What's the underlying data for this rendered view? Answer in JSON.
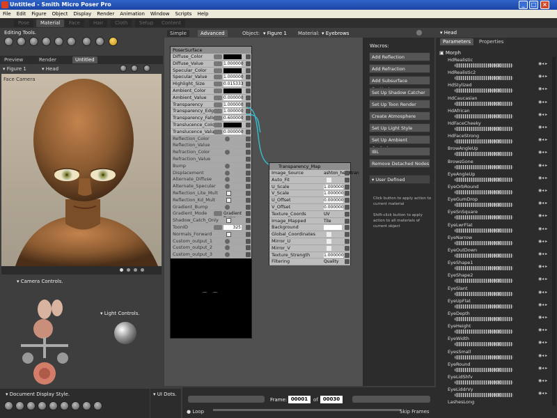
{
  "window": {
    "title": "Untitled - Smith Micro Poser Pro"
  },
  "menu": [
    "File",
    "Edit",
    "Figure",
    "Object",
    "Display",
    "Render",
    "Animation",
    "Window",
    "Scripts",
    "Help"
  ],
  "rooms": [
    {
      "label": "Pose",
      "active": false
    },
    {
      "label": "Material",
      "active": true
    },
    {
      "label": "Face",
      "active": false
    },
    {
      "label": "Hair",
      "active": false
    },
    {
      "label": "Cloth",
      "active": false
    },
    {
      "label": "Setup",
      "active": false
    },
    {
      "label": "Content",
      "active": false
    }
  ],
  "editing_tools": {
    "label": "Editing Tools."
  },
  "doc_tabs": [
    "Preview",
    "Render",
    "Untitled"
  ],
  "figure_select": {
    "figure": "Figure 1",
    "part": "Head"
  },
  "viewport": {
    "camera": "Face Camera"
  },
  "camera_controls": {
    "label": "Camera Controls."
  },
  "light_controls": {
    "label": "Light Controls."
  },
  "doc_display": {
    "label": "Document Display Style."
  },
  "ui_dots": {
    "label": "UI Dots."
  },
  "material_tabs": {
    "simple": "Simple",
    "advanced": "Advanced",
    "object_label": "Object:",
    "object_value": "Figure 1",
    "material_label": "Material:",
    "material_value": "Eyebrows"
  },
  "poser_surface": {
    "title": "PoserSurface",
    "rows": [
      {
        "label": "Diffuse_Color",
        "type": "color",
        "value": ""
      },
      {
        "label": "Diffuse_Value",
        "type": "num",
        "value": "1.000000"
      },
      {
        "label": "Specular_Color",
        "type": "color",
        "value": ""
      },
      {
        "label": "Specular_Value",
        "type": "num",
        "value": "1.000000"
      },
      {
        "label": "Highlight_Size",
        "type": "num",
        "value": "0.015333"
      },
      {
        "label": "Ambient_Color",
        "type": "color",
        "value": ""
      },
      {
        "label": "Ambient_Value",
        "type": "num",
        "value": "0.000000"
      },
      {
        "label": "Transparency",
        "type": "num",
        "value": "1.000000"
      },
      {
        "label": "Transparency_Edge",
        "type": "num",
        "value": "1.000000"
      },
      {
        "label": "Transparency_Falloff",
        "type": "num",
        "value": "0.600000"
      },
      {
        "label": "Translucence_Color",
        "type": "color",
        "value": ""
      },
      {
        "label": "Translucence_Value",
        "type": "num",
        "value": "0.000000"
      },
      {
        "label": "Reflection_Color",
        "type": "q",
        "value": ""
      },
      {
        "label": "Reflection_Value",
        "type": "plain",
        "value": ""
      },
      {
        "label": "Refraction_Color",
        "type": "q",
        "value": ""
      },
      {
        "label": "Refraction_Value",
        "type": "plain",
        "value": ""
      },
      {
        "label": "Bump",
        "type": "q",
        "value": ""
      },
      {
        "label": "Displacement",
        "type": "q",
        "value": ""
      },
      {
        "label": "Alternate_Diffuse",
        "type": "q",
        "value": ""
      },
      {
        "label": "Alternate_Specular",
        "type": "q",
        "value": ""
      },
      {
        "label": "Reflection_Lite_Mult",
        "type": "cb",
        "value": ""
      },
      {
        "label": "Reflection_Kd_Mult",
        "type": "cb",
        "value": ""
      },
      {
        "label": "Gradient_Bump",
        "type": "q",
        "value": ""
      },
      {
        "label": "Gradient_Mode",
        "type": "text",
        "value": "Gradient Bump"
      },
      {
        "label": "Shadow_Catch_Only",
        "type": "cb",
        "value": ""
      },
      {
        "label": "ToonID",
        "type": "num",
        "value": "325"
      },
      {
        "label": "Normals_Forward",
        "type": "cb",
        "value": ""
      },
      {
        "label": "Custom_output_1",
        "type": "q",
        "value": ""
      },
      {
        "label": "Custom_output_2",
        "type": "q",
        "value": ""
      },
      {
        "label": "Custom_output_3",
        "type": "q",
        "value": ""
      }
    ]
  },
  "transparency_map": {
    "title": "Transparency_Map",
    "rows": [
      {
        "label": "Image_Source",
        "value": "ashton_headtran"
      },
      {
        "label": "Auto_Fit",
        "value": ""
      },
      {
        "label": "U_Scale",
        "value": "1.000000"
      },
      {
        "label": "V_Scale",
        "value": "1.000000"
      },
      {
        "label": "U_Offset",
        "value": "0.000000"
      },
      {
        "label": "V_Offset",
        "value": "0.000000"
      },
      {
        "label": "Texture_Coords",
        "value": "UV"
      },
      {
        "label": "Image_Mapped",
        "value": "Tile"
      },
      {
        "label": "Background",
        "value": ""
      },
      {
        "label": "Global_Coordinates",
        "value": ""
      },
      {
        "label": "Mirror_U",
        "value": ""
      },
      {
        "label": "Mirror_V",
        "value": ""
      },
      {
        "label": "Texture_Strength",
        "value": "1.000000"
      },
      {
        "label": "Filtering",
        "value": "Quality"
      }
    ]
  },
  "wacros": {
    "title": "Wacros:",
    "buttons": [
      "Add Reflection",
      "Add Refraction",
      "Add Subsurface Scattering",
      "Set Up Shadow Catcher",
      "Set Up Toon Render",
      "Create Atmosphere",
      "Set Up Light Style",
      "Set Up Ambient Occlusion",
      "IBL",
      "Remove Detached Nodes"
    ],
    "user_defined": "User Defined",
    "hint1": "Click button to apply action to current material",
    "hint2": "Shift-click button to apply action to all materials of current object"
  },
  "right_panel": {
    "title": "Head",
    "tab_parameters": "Parameters",
    "tab_properties": "Properties",
    "group": "Morph"
  },
  "morphs": [
    {
      "name": "HdRealistic",
      "value": "0.000"
    },
    {
      "name": "HdRealistic2",
      "value": "0.000"
    },
    {
      "name": "HdStylized",
      "value": "0.000"
    },
    {
      "name": "HdCaucasian",
      "value": "0.000"
    },
    {
      "name": "HdAfrican",
      "value": "0.000"
    },
    {
      "name": "HdFaceCheeky",
      "value": "0.000"
    },
    {
      "name": "HdFaceStrong",
      "value": "0.000"
    },
    {
      "name": "BrowAngleUp",
      "value": "0.000"
    },
    {
      "name": "BrowsGone",
      "value": "0.000"
    },
    {
      "name": "EyeAngleUp",
      "value": "0.000"
    },
    {
      "name": "EyeOrbRound",
      "value": "0.000"
    },
    {
      "name": "EyeGumDrop",
      "value": "0.000"
    },
    {
      "name": "EyeSnSquare",
      "value": "0.000"
    },
    {
      "name": "EyeLwrFlat",
      "value": "0.000"
    },
    {
      "name": "EyeNarrow",
      "value": "0.000"
    },
    {
      "name": "EyeOutDown",
      "value": "0.000"
    },
    {
      "name": "EyeShape1",
      "value": "0.000"
    },
    {
      "name": "EyeShape2",
      "value": "0.000"
    },
    {
      "name": "EyeSlant",
      "value": "0.000"
    },
    {
      "name": "EyeUpFlat",
      "value": "0.000"
    },
    {
      "name": "EyeDepth",
      "value": "0.000"
    },
    {
      "name": "EyeHeight",
      "value": "0.000"
    },
    {
      "name": "EyeWidth",
      "value": "0.000"
    },
    {
      "name": "EyesSmall",
      "value": "0.000"
    },
    {
      "name": "EyeRound",
      "value": "0.000"
    },
    {
      "name": "EyeLidShfv",
      "value": "0.000"
    },
    {
      "name": "EyeLiddrVy",
      "value": "0.000"
    },
    {
      "name": "LashesLong",
      "value": ""
    }
  ],
  "timeline": {
    "frame_label": "Frame:",
    "frame_value": "00001",
    "of_label": "of",
    "total_value": "00030",
    "loop_label": "Loop",
    "skip_label": "Skip Frames"
  },
  "colors": {
    "accent": "#f0b020",
    "connector": "#3ab8c8",
    "node_bg": "#bdbdbd",
    "panel": "#3e3e3e"
  }
}
